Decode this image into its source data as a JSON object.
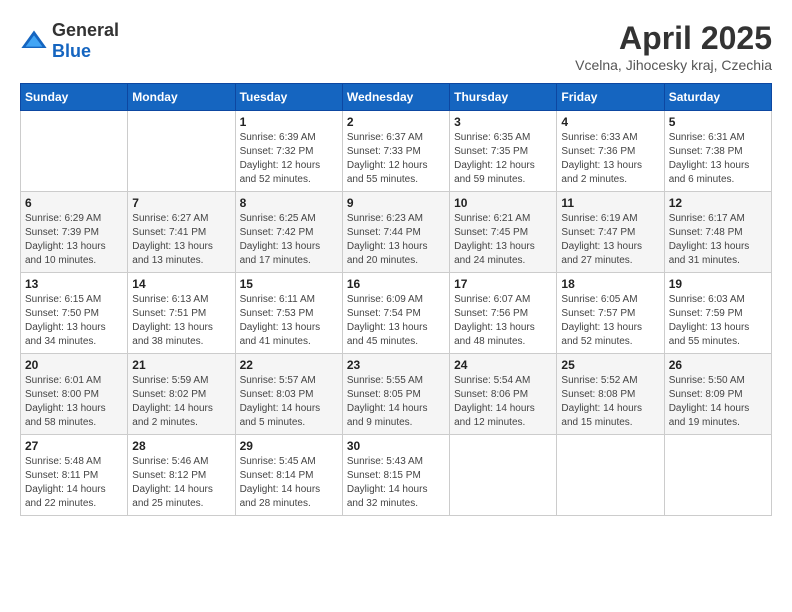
{
  "logo": {
    "text_general": "General",
    "text_blue": "Blue"
  },
  "title": "April 2025",
  "subtitle": "Vcelna, Jihocesky kraj, Czechia",
  "days_of_week": [
    "Sunday",
    "Monday",
    "Tuesday",
    "Wednesday",
    "Thursday",
    "Friday",
    "Saturday"
  ],
  "weeks": [
    [
      {
        "day": "",
        "info": ""
      },
      {
        "day": "",
        "info": ""
      },
      {
        "day": "1",
        "info": "Sunrise: 6:39 AM\nSunset: 7:32 PM\nDaylight: 12 hours and 52 minutes."
      },
      {
        "day": "2",
        "info": "Sunrise: 6:37 AM\nSunset: 7:33 PM\nDaylight: 12 hours and 55 minutes."
      },
      {
        "day": "3",
        "info": "Sunrise: 6:35 AM\nSunset: 7:35 PM\nDaylight: 12 hours and 59 minutes."
      },
      {
        "day": "4",
        "info": "Sunrise: 6:33 AM\nSunset: 7:36 PM\nDaylight: 13 hours and 2 minutes."
      },
      {
        "day": "5",
        "info": "Sunrise: 6:31 AM\nSunset: 7:38 PM\nDaylight: 13 hours and 6 minutes."
      }
    ],
    [
      {
        "day": "6",
        "info": "Sunrise: 6:29 AM\nSunset: 7:39 PM\nDaylight: 13 hours and 10 minutes."
      },
      {
        "day": "7",
        "info": "Sunrise: 6:27 AM\nSunset: 7:41 PM\nDaylight: 13 hours and 13 minutes."
      },
      {
        "day": "8",
        "info": "Sunrise: 6:25 AM\nSunset: 7:42 PM\nDaylight: 13 hours and 17 minutes."
      },
      {
        "day": "9",
        "info": "Sunrise: 6:23 AM\nSunset: 7:44 PM\nDaylight: 13 hours and 20 minutes."
      },
      {
        "day": "10",
        "info": "Sunrise: 6:21 AM\nSunset: 7:45 PM\nDaylight: 13 hours and 24 minutes."
      },
      {
        "day": "11",
        "info": "Sunrise: 6:19 AM\nSunset: 7:47 PM\nDaylight: 13 hours and 27 minutes."
      },
      {
        "day": "12",
        "info": "Sunrise: 6:17 AM\nSunset: 7:48 PM\nDaylight: 13 hours and 31 minutes."
      }
    ],
    [
      {
        "day": "13",
        "info": "Sunrise: 6:15 AM\nSunset: 7:50 PM\nDaylight: 13 hours and 34 minutes."
      },
      {
        "day": "14",
        "info": "Sunrise: 6:13 AM\nSunset: 7:51 PM\nDaylight: 13 hours and 38 minutes."
      },
      {
        "day": "15",
        "info": "Sunrise: 6:11 AM\nSunset: 7:53 PM\nDaylight: 13 hours and 41 minutes."
      },
      {
        "day": "16",
        "info": "Sunrise: 6:09 AM\nSunset: 7:54 PM\nDaylight: 13 hours and 45 minutes."
      },
      {
        "day": "17",
        "info": "Sunrise: 6:07 AM\nSunset: 7:56 PM\nDaylight: 13 hours and 48 minutes."
      },
      {
        "day": "18",
        "info": "Sunrise: 6:05 AM\nSunset: 7:57 PM\nDaylight: 13 hours and 52 minutes."
      },
      {
        "day": "19",
        "info": "Sunrise: 6:03 AM\nSunset: 7:59 PM\nDaylight: 13 hours and 55 minutes."
      }
    ],
    [
      {
        "day": "20",
        "info": "Sunrise: 6:01 AM\nSunset: 8:00 PM\nDaylight: 13 hours and 58 minutes."
      },
      {
        "day": "21",
        "info": "Sunrise: 5:59 AM\nSunset: 8:02 PM\nDaylight: 14 hours and 2 minutes."
      },
      {
        "day": "22",
        "info": "Sunrise: 5:57 AM\nSunset: 8:03 PM\nDaylight: 14 hours and 5 minutes."
      },
      {
        "day": "23",
        "info": "Sunrise: 5:55 AM\nSunset: 8:05 PM\nDaylight: 14 hours and 9 minutes."
      },
      {
        "day": "24",
        "info": "Sunrise: 5:54 AM\nSunset: 8:06 PM\nDaylight: 14 hours and 12 minutes."
      },
      {
        "day": "25",
        "info": "Sunrise: 5:52 AM\nSunset: 8:08 PM\nDaylight: 14 hours and 15 minutes."
      },
      {
        "day": "26",
        "info": "Sunrise: 5:50 AM\nSunset: 8:09 PM\nDaylight: 14 hours and 19 minutes."
      }
    ],
    [
      {
        "day": "27",
        "info": "Sunrise: 5:48 AM\nSunset: 8:11 PM\nDaylight: 14 hours and 22 minutes."
      },
      {
        "day": "28",
        "info": "Sunrise: 5:46 AM\nSunset: 8:12 PM\nDaylight: 14 hours and 25 minutes."
      },
      {
        "day": "29",
        "info": "Sunrise: 5:45 AM\nSunset: 8:14 PM\nDaylight: 14 hours and 28 minutes."
      },
      {
        "day": "30",
        "info": "Sunrise: 5:43 AM\nSunset: 8:15 PM\nDaylight: 14 hours and 32 minutes."
      },
      {
        "day": "",
        "info": ""
      },
      {
        "day": "",
        "info": ""
      },
      {
        "day": "",
        "info": ""
      }
    ]
  ]
}
